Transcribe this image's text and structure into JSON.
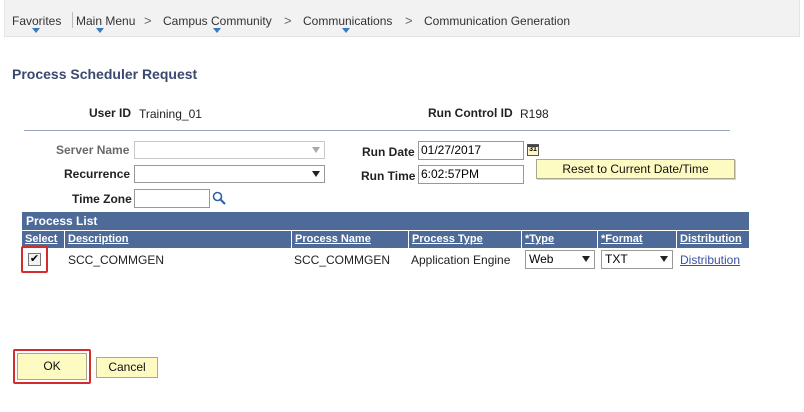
{
  "breadcrumb": {
    "items": [
      "Favorites",
      "Main Menu",
      "Campus Community",
      "Communications",
      "Communication Generation"
    ],
    "separator": ">"
  },
  "page": {
    "title": "Process Scheduler Request"
  },
  "run_control": {
    "user_id_label": "User ID",
    "user_id_value": "Training_01",
    "run_control_id_label": "Run Control ID",
    "run_control_id_value": "R198"
  },
  "form": {
    "server_name_label": "Server Name",
    "server_name_value": "",
    "recurrence_label": "Recurrence",
    "recurrence_value": "",
    "time_zone_label": "Time Zone",
    "time_zone_value": "",
    "run_date_label": "Run Date",
    "run_date_value": "01/27/2017",
    "run_time_label": "Run Time",
    "run_time_value": "6:02:57PM",
    "calendar_icon_text": "31",
    "reset_button_label": "Reset to Current Date/Time"
  },
  "process_list": {
    "title": "Process List",
    "columns": [
      "Select",
      "Description",
      "Process Name",
      "Process Type",
      "*Type",
      "*Format",
      "Distribution"
    ],
    "rows": [
      {
        "selected": true,
        "description": "SCC_COMMGEN",
        "process_name": "SCC_COMMGEN",
        "process_type": "Application Engine",
        "type": "Web",
        "format": "TXT",
        "distribution": "Distribution"
      }
    ]
  },
  "actions": {
    "ok_label": "OK",
    "cancel_label": "Cancel"
  },
  "colors": {
    "grid_header": "#4e6a99",
    "button_yellow": "#fdfbc2",
    "highlight_red": "#d42c2c",
    "link": "#3a4fa5",
    "title": "#3a4a6e"
  },
  "icons": {
    "calendar": "calendar-icon",
    "lookup": "magnifier-icon",
    "check": "checkmark-icon"
  }
}
